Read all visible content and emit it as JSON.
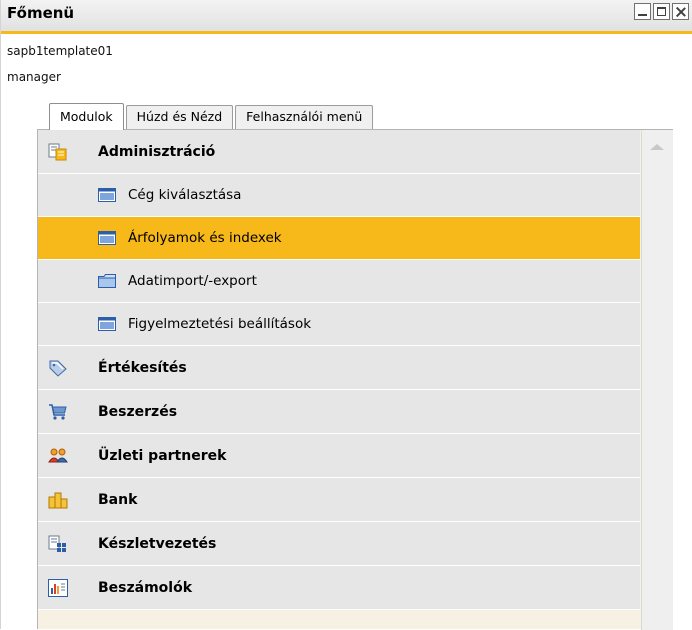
{
  "window": {
    "title": "Főmenü",
    "buttons": {
      "minimize": "minimize",
      "maximize": "maximize",
      "close": "close"
    }
  },
  "session": {
    "database": "sapb1template01",
    "user": "manager"
  },
  "tabs": [
    {
      "label": "Modulok",
      "active": true
    },
    {
      "label": "Húzd és Nézd",
      "active": false
    },
    {
      "label": "Felhasználói menü",
      "active": false
    }
  ],
  "modules": {
    "admin": {
      "label": "Adminisztráció",
      "icon": "administration-icon"
    },
    "sub": [
      {
        "label": "Cég kiválasztása",
        "icon": "window-icon"
      },
      {
        "label": "Árfolyamok és indexek",
        "icon": "window-icon",
        "selected": true
      },
      {
        "label": "Adatimport/-export",
        "icon": "folder-icon"
      },
      {
        "label": "Figyelmeztetési beállítások",
        "icon": "window-icon"
      }
    ],
    "sales": {
      "label": "Értékesítés",
      "icon": "sales-tag-icon"
    },
    "purchasing": {
      "label": "Beszerzés",
      "icon": "shopping-cart-icon"
    },
    "partners": {
      "label": "Üzleti partnerek",
      "icon": "business-partners-icon"
    },
    "bank": {
      "label": "Bank",
      "icon": "coins-icon"
    },
    "inventory": {
      "label": "Készletvezetés",
      "icon": "inventory-icon"
    },
    "reports": {
      "label": "Beszámolók",
      "icon": "reports-chart-icon"
    }
  },
  "colors": {
    "accent": "#f7b81a",
    "row_bg": "#e6e6e6",
    "panel_bg": "#f6f1e2"
  }
}
